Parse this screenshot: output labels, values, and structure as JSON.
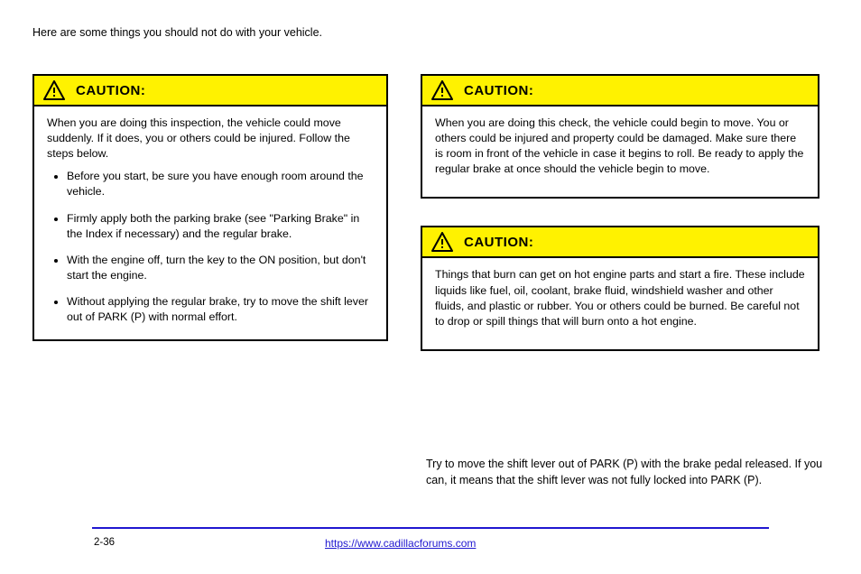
{
  "intro": "Here are some things you should not do with your vehicle.",
  "cautionLabel": "CAUTION:",
  "box1": {
    "body": [
      "When you are doing this check, the vehicle could begin to move. You or others could be injured and property could be damaged. Make sure there is room in front of the vehicle in case it begins to roll. Be ready to apply the regular brake at once should the vehicle begin to move."
    ]
  },
  "box2": {
    "lead": "When you are doing this inspection, the vehicle could move suddenly. If it does, you or others could be injured. Follow the steps below.",
    "items": [
      "Before you start, be sure you have enough room around the vehicle.",
      "Firmly apply both the parking brake (see \"Parking Brake\" in the Index if necessary) and the regular brake.",
      "With the engine off, turn the key to the ON position, but don't start the engine.",
      "Without applying the regular brake, try to move the shift lever out of PARK (P) with normal effort."
    ]
  },
  "box3": {
    "body": [
      "Things that burn can get on hot engine parts and start a fire. These include liquids like fuel, oil, coolant, brake fluid, windshield washer and other fluids, and plastic or rubber. You or others could be burned. Be careful not to drop or spill things that will burn onto a hot engine."
    ]
  },
  "outro": [
    "Try to move the shift lever out of PARK (P) with the brake pedal released. If you can, it means that the shift lever was not fully locked into PARK (P)."
  ],
  "footerPage": "2-36",
  "footerLink": "https://www.cadillacforums.com"
}
